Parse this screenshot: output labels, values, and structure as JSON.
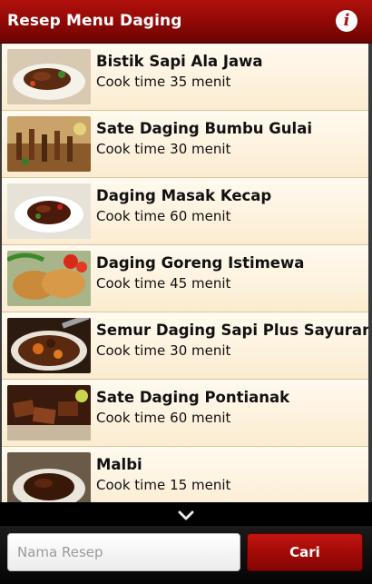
{
  "app": {
    "title": "Resep Menu Daging",
    "info_icon": "info-icon",
    "accent_color": "#a30b08"
  },
  "recipes": [
    {
      "name": "Bistik Sapi Ala Jawa",
      "cook_label": "Cook time",
      "cook_time": "35 menit"
    },
    {
      "name": "Sate Daging Bumbu Gulai",
      "cook_label": "Cook time",
      "cook_time": "30 menit"
    },
    {
      "name": "Daging Masak Kecap",
      "cook_label": "Cook time",
      "cook_time": "60 menit"
    },
    {
      "name": "Daging Goreng Istimewa",
      "cook_label": "Cook time",
      "cook_time": "45 menit"
    },
    {
      "name": "Semur Daging Sapi Plus Sayuran",
      "cook_label": "Cook time",
      "cook_time": "30 menit"
    },
    {
      "name": "Sate Daging Pontianak",
      "cook_label": "Cook time",
      "cook_time": "60 menit"
    },
    {
      "name": "Malbi",
      "cook_label": "Cook time",
      "cook_time": "15 menit"
    }
  ],
  "more_indicator": "chevron-down-icon",
  "search": {
    "placeholder": "Nama Resep",
    "value": "",
    "button_label": "Cari"
  }
}
